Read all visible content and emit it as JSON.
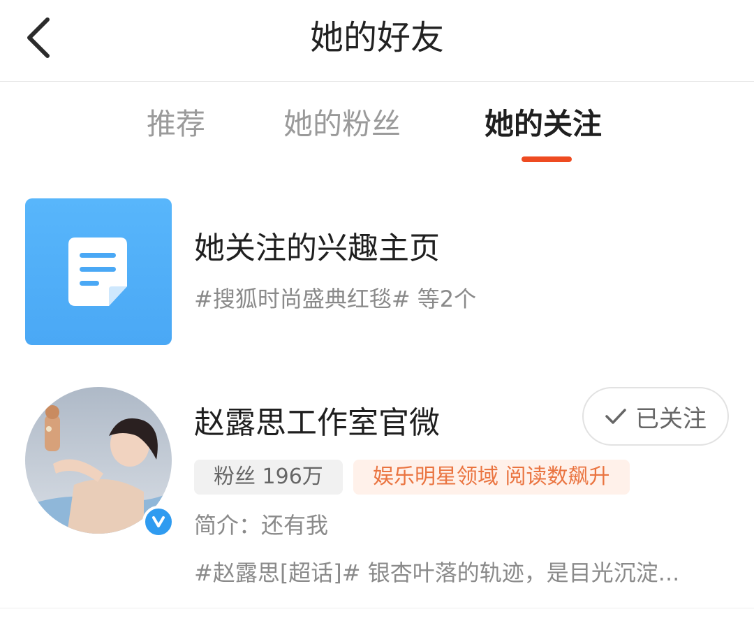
{
  "header": {
    "title": "她的好友",
    "back_icon": "chevron-left-icon"
  },
  "tabs": [
    {
      "label": "推荐",
      "active": false
    },
    {
      "label": "她的粉丝",
      "active": false
    },
    {
      "label": "她的关注",
      "active": true
    }
  ],
  "interest": {
    "title": "她关注的兴趣主页",
    "subtitle": "#搜狐时尚盛典红毯# 等2个",
    "icon": "document-icon"
  },
  "user": {
    "name": "赵露思工作室官微",
    "follow_label": "已关注",
    "follow_icon": "check-icon",
    "fans": "粉丝 196万",
    "domain_tag": "娱乐明星领域 阅读数飙升",
    "bio": "简介：还有我",
    "latest_post": "#赵露思[超话]# 银杏叶落的轨迹，是目光沉淀...",
    "verified_icon": "verified-v-icon"
  },
  "colors": {
    "accent": "#ee4b21",
    "tile_blue": "#4aa8f5",
    "domain_text": "#ea7440",
    "domain_bg": "#fff1ea",
    "verified": "#2f9bf0"
  }
}
